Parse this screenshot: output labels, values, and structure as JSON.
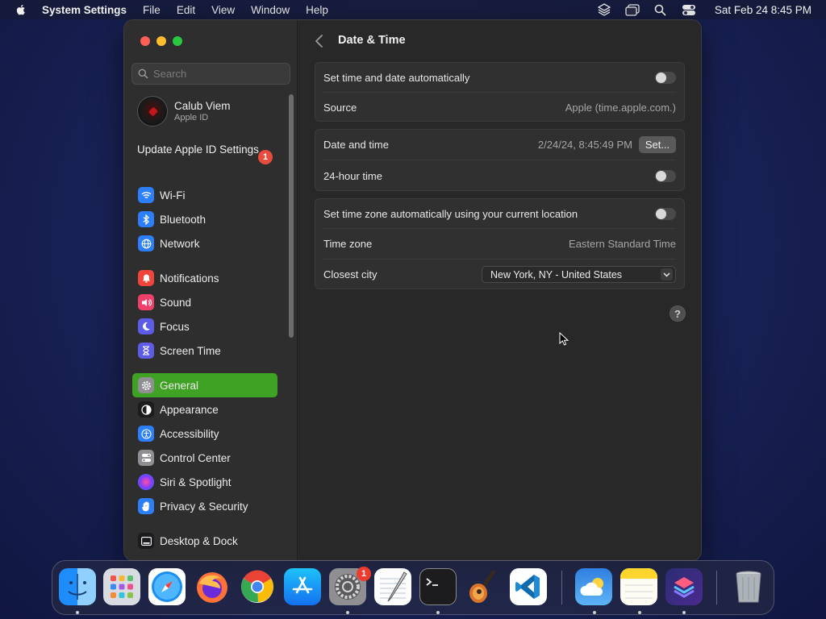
{
  "menubar": {
    "app_name": "System Settings",
    "menus": [
      "File",
      "Edit",
      "View",
      "Window",
      "Help"
    ],
    "clock": "Sat Feb 24  8:45 PM"
  },
  "sidebar": {
    "search_placeholder": "Search",
    "account": {
      "name": "Calub Viem",
      "sub": "Apple ID"
    },
    "update": {
      "label": "Update Apple ID Settings",
      "badge": "1"
    },
    "groups": [
      [
        {
          "label": "Wi-Fi",
          "icon": "wifi-icon",
          "color": "#2d7ff9"
        },
        {
          "label": "Bluetooth",
          "icon": "bluetooth-icon",
          "color": "#2d7ff9"
        },
        {
          "label": "Network",
          "icon": "globe-icon",
          "color": "#2d7ff9"
        }
      ],
      [
        {
          "label": "Notifications",
          "icon": "bell-icon",
          "color": "#f0453a"
        },
        {
          "label": "Sound",
          "icon": "speaker-icon",
          "color": "#ef3f6b"
        },
        {
          "label": "Focus",
          "icon": "moon-icon",
          "color": "#5e5ce6"
        },
        {
          "label": "Screen Time",
          "icon": "hourglass-icon",
          "color": "#5e5ce6"
        }
      ],
      [
        {
          "label": "General",
          "icon": "gear-icon",
          "color": "#8e8e93",
          "active": true
        },
        {
          "label": "Appearance",
          "icon": "appearance-icon",
          "color": "#1c1c1e"
        },
        {
          "label": "Accessibility",
          "icon": "accessibility-icon",
          "color": "#2d7ff9"
        },
        {
          "label": "Control Center",
          "icon": "control-center-icon",
          "color": "#8e8e93"
        },
        {
          "label": "Siri & Spotlight",
          "icon": "siri-icon",
          "color": "#b04bdc"
        },
        {
          "label": "Privacy & Security",
          "icon": "hand-icon",
          "color": "#2d7ff9"
        }
      ],
      [
        {
          "label": "Desktop & Dock",
          "icon": "dock-icon",
          "color": "#1c1c1e"
        }
      ]
    ]
  },
  "content": {
    "title": "Date & Time",
    "auto_time": {
      "label": "Set time and date automatically",
      "on": false
    },
    "source": {
      "label": "Source",
      "value": "Apple (time.apple.com.)"
    },
    "date_time": {
      "label": "Date and time",
      "value": "2/24/24, 8:45:49 PM",
      "button": "Set..."
    },
    "hour24": {
      "label": "24-hour time",
      "on": false
    },
    "auto_tz": {
      "label": "Set time zone automatically using your current location",
      "on": false
    },
    "time_zone": {
      "label": "Time zone",
      "value": "Eastern Standard Time"
    },
    "closest_city": {
      "label": "Closest city",
      "value": "New York, NY - United States"
    },
    "help": "?"
  },
  "dock": {
    "system_settings_badge": "1",
    "apps": [
      "Finder",
      "Launchpad",
      "Safari",
      "Firefox",
      "Chrome",
      "App Store",
      "System Settings",
      "TextEdit",
      "Terminal",
      "GarageBand",
      "Visual Studio Code",
      "Weather",
      "Notes",
      "Shortcuts",
      "Trash"
    ]
  }
}
